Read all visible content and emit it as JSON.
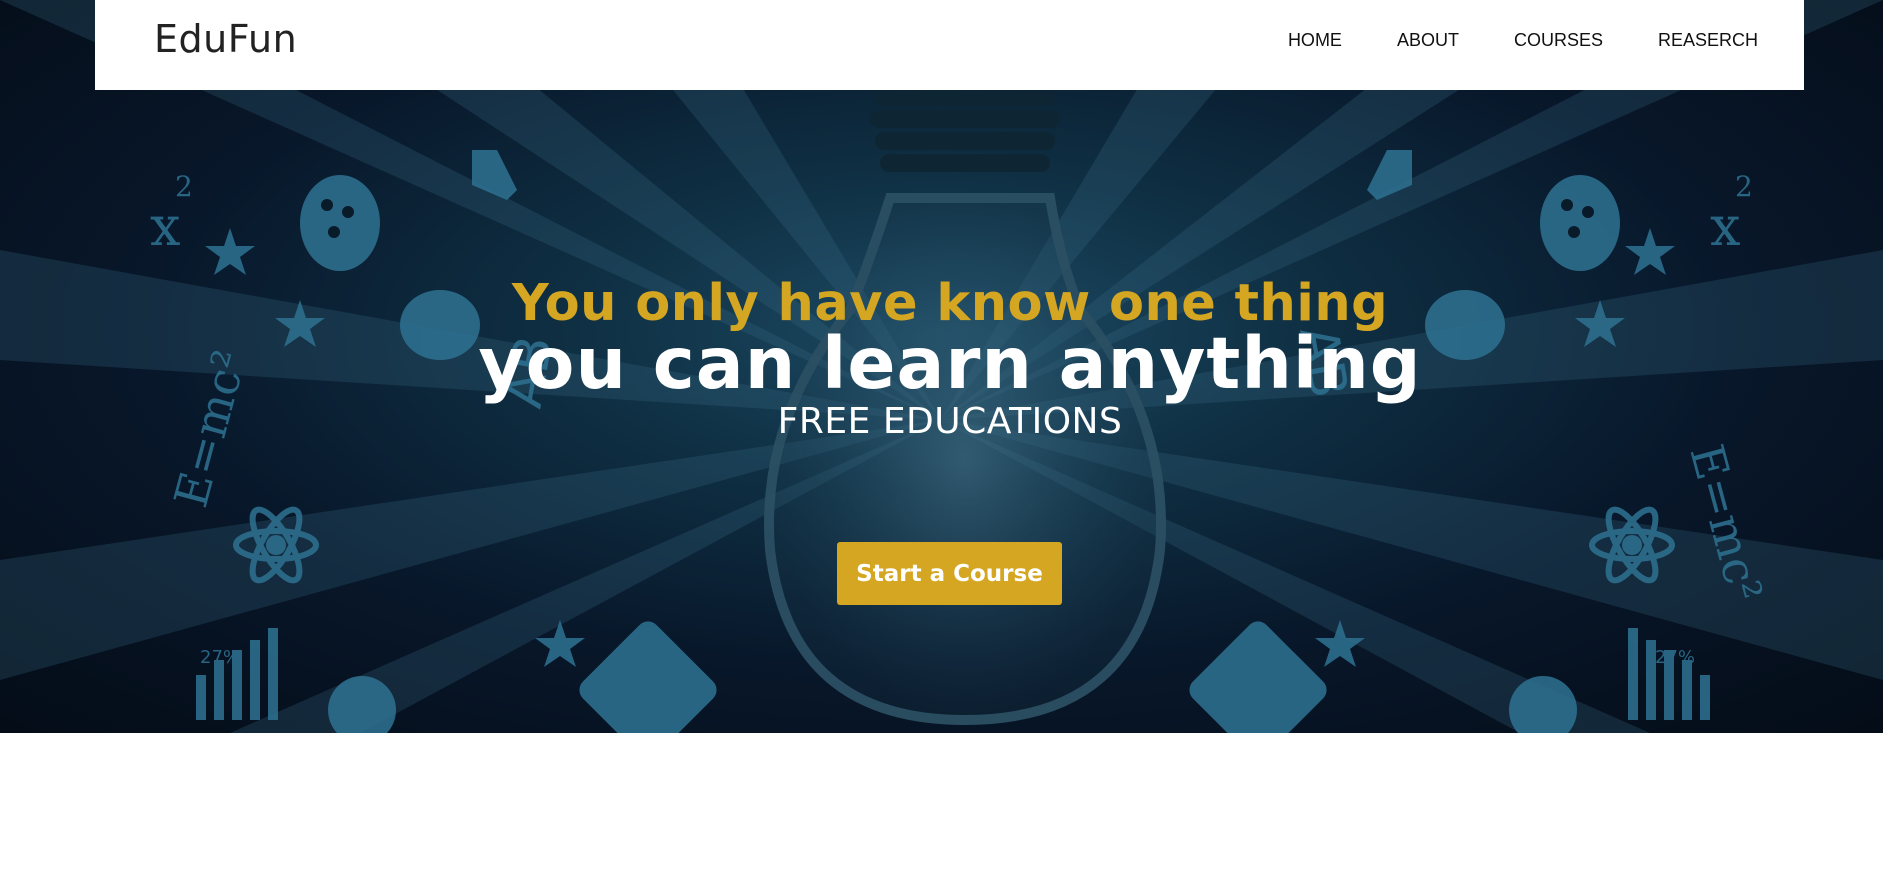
{
  "brand": "EduFun",
  "nav": {
    "items": [
      "HOME",
      "ABOUT",
      "COURSES",
      "REASERCH"
    ]
  },
  "hero": {
    "kicker": "You only have know one thing",
    "title": "you can learn anything",
    "subtitle": "FREE EDUCATIONS",
    "cta_label": "Start a Course"
  },
  "colors": {
    "accent": "#d4a621",
    "hero_dark": "#040c17",
    "icon_teal": "#2d6f8e"
  },
  "decor_icons": [
    "lightbulb-icon",
    "atom-icon",
    "palette-icon",
    "brain-icon",
    "star-icon",
    "microscope-icon",
    "formula-icon",
    "bar-chart-icon",
    "globe-icon",
    "calculator-icon"
  ]
}
